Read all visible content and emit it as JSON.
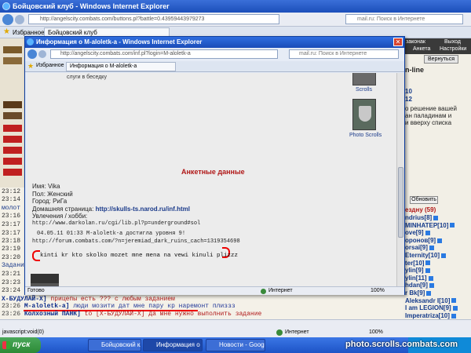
{
  "bg_window": {
    "title": "Бойцовский клуб - Windows Internet Explorer",
    "address": "http://angelscity.combats.com/buttons.pl?battle=0.43959443979273",
    "search_placeholder": "mail.ru: Поиск в Интернете",
    "favorites": "Избранное",
    "tab": "Бойцовский клуб",
    "top_links": {
      "a": "законак",
      "b": "Выход",
      "c": "Анкета",
      "d": "Настройки"
    },
    "return_button": "Вернуться",
    "online_label": "n-line"
  },
  "right_panel": {
    "scroll_text_1": "о решение вашей",
    "scroll_text_2": "ан паладинам и",
    "scroll_text_3": "и вверху списка",
    "refresh_button": "Обновить",
    "room": "ездну (59)",
    "users": [
      {
        "name": "ndrius[8]"
      },
      {
        "name": "MINHATEP[10]"
      },
      {
        "name": "ove[9]"
      },
      {
        "name": "оронов[9]"
      },
      {
        "name": "orsai[9]"
      },
      {
        "name": "Eternity[10]"
      },
      {
        "name": "ter[10]"
      },
      {
        "name": "ylin[9]"
      },
      {
        "name": "ylin[11]"
      },
      {
        "name": "hdan[9]"
      },
      {
        "name": "r Bk[9]"
      },
      {
        "name": "Aleksandr I[10]"
      },
      {
        "name": "I am LEGION[9]"
      },
      {
        "name": "Imperatriza[10]"
      }
    ],
    "row_numbers": [
      "10",
      "12"
    ]
  },
  "popup": {
    "title": "Информация о M-aloletk-a - Windows Internet Explorer",
    "address": "http://angelscity.combats.com/inf.pl?login=M-aloletk-a",
    "search_placeholder": "mail.ru: Поиск в Интернете",
    "favorites": "Избранное",
    "tab": "Информация о M-aloletk-a",
    "top_text": "слуги в беседку",
    "scrolls_label": "Scrolls",
    "photo_scrolls_label": "Photo Scrolls",
    "section_title": "Анкетные данные",
    "fields": [
      "Имя: Vika",
      "Пол: Женский",
      "Город: РиГа"
    ],
    "homepage_label": "Домашняя страница:",
    "homepage_url": "http://skulls-ts.narod.ru/inf.html",
    "hobby_label": "Увлечения / хобби:",
    "hobby_url": "http://www.darkolan.ru/cgi/lib.pl?p=underground#sol",
    "log_line_1": "04.05.11 01:33 M-aloletk-a достигла уровня 9!",
    "log_line_2": "http://forum.combats.com/?n=jeremiad_dark_ruins_cach=1319354698",
    "message": "kinti kr kto skolko mozet mne mena na vewi kinuli plizzz",
    "status_left": "Готово",
    "status_zone": "Интернет",
    "status_zoom": "100%"
  },
  "chat": {
    "lines": [
      {
        "ts": "23:12",
        "nick": "",
        "msg": ""
      },
      {
        "ts": "23:14",
        "nick": "",
        "msg": ""
      },
      {
        "ts": "23:16",
        "nick": "",
        "msg": ""
      },
      {
        "ts": "23:17",
        "nick": "",
        "msg": ""
      },
      {
        "ts": "23:17",
        "nick": "",
        "msg": ""
      },
      {
        "ts": "23:18",
        "nick": "",
        "msg": ""
      },
      {
        "ts": "23:19",
        "nick": "",
        "msg": ""
      },
      {
        "ts": "23:20",
        "nick": "",
        "msg": ""
      },
      {
        "ts": "23:21",
        "nick": "",
        "msg": ""
      },
      {
        "ts": "23:23",
        "nick": "",
        "msg": ""
      },
      {
        "ts": "23:24",
        "nick": "",
        "msg": ""
      },
      {
        "ts": "23:25",
        "nick": "",
        "msg": ""
      }
    ],
    "side_words": [
      "молот",
      "Задани"
    ],
    "visible_lines": [
      {
        "ts": "",
        "nick": "Х-БУДУЛАЙ-Х]",
        "msg": "прицепы есть ??? с любым заданием",
        "cls": "msg-red"
      },
      {
        "ts": "23:26",
        "nick": "M-aloletk-a]",
        "msg": "люди мозити дат мне пару кр наремонт плиззз",
        "cls": "msg-blue"
      },
      {
        "ts": "23:26",
        "nick": "Колхозный ПАНК]",
        "msg": "to [Х-БУДУЛАЙ-Х] Да мне нужно выполнить задание",
        "cls": "msg-red"
      }
    ]
  },
  "bg_status": {
    "left": "javascript:void(0)",
    "zone": "Интернет",
    "zoom": "100%"
  },
  "taskbar": {
    "start": "пуск",
    "buttons": [
      "Бойцовский клуб - ...",
      "Информация о M-al...",
      "Новости - Google Ch..."
    ]
  },
  "watermark": "photo.scrolls.combats.com"
}
